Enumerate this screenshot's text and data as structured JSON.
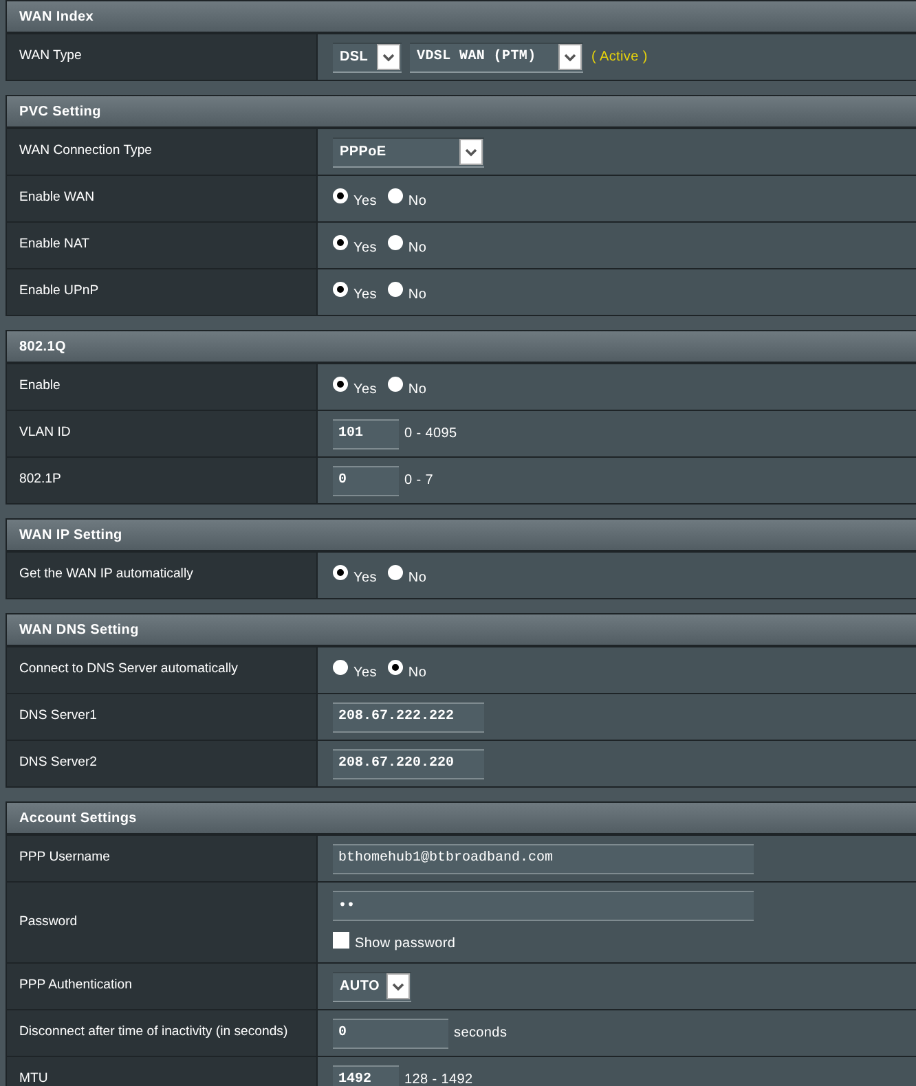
{
  "sections": [
    {
      "title": "WAN Index",
      "rows": [
        {
          "label": "WAN Type",
          "kind": "select",
          "selects": [
            "DSL",
            "VDSL WAN (PTM)"
          ],
          "note": "( Active )"
        }
      ]
    },
    {
      "title": "PVC Setting",
      "rows": [
        {
          "label": "WAN Connection Type",
          "kind": "select",
          "selects": [
            "PPPoE"
          ]
        },
        {
          "label": "Enable WAN",
          "kind": "radio",
          "options": [
            {
              "label": "Yes",
              "selected": true
            },
            {
              "label": "No",
              "selected": false
            }
          ]
        },
        {
          "label": "Enable NAT",
          "kind": "radio",
          "options": [
            {
              "label": "Yes",
              "selected": true
            },
            {
              "label": "No",
              "selected": false
            }
          ]
        },
        {
          "label": "Enable UPnP",
          "kind": "radio",
          "options": [
            {
              "label": "Yes",
              "selected": true
            },
            {
              "label": "No",
              "selected": false
            }
          ]
        }
      ]
    },
    {
      "title": "802.1Q",
      "rows": [
        {
          "label": "Enable",
          "kind": "radio",
          "options": [
            {
              "label": "Yes",
              "selected": true
            },
            {
              "label": "No",
              "selected": false
            }
          ]
        },
        {
          "label": "VLAN ID",
          "kind": "input",
          "value": "101",
          "suffix": "0 - 4095"
        },
        {
          "label": "802.1P",
          "kind": "input",
          "value": "0",
          "suffix": "0 - 7"
        }
      ]
    },
    {
      "title": "WAN IP Setting",
      "rows": [
        {
          "label": "Get the WAN IP automatically",
          "kind": "radio",
          "options": [
            {
              "label": "Yes",
              "selected": true
            },
            {
              "label": "No",
              "selected": false
            }
          ]
        }
      ]
    },
    {
      "title": "WAN DNS Setting",
      "rows": [
        {
          "label": "Connect to DNS Server automatically",
          "kind": "radio",
          "options": [
            {
              "label": "Yes",
              "selected": false
            },
            {
              "label": "No",
              "selected": true
            }
          ]
        },
        {
          "label": "DNS Server1",
          "kind": "input",
          "value": "208.67.222.222"
        },
        {
          "label": "DNS Server2",
          "kind": "input",
          "value": "208.67.220.220"
        }
      ]
    },
    {
      "title": "Account Settings",
      "rows": [
        {
          "label": "PPP Username",
          "kind": "input",
          "value": "bthomehub1@btbroadband.com"
        },
        {
          "label": "Password",
          "kind": "password",
          "value": "••",
          "checkbox": {
            "label": "Show password",
            "checked": false
          }
        },
        {
          "label": "PPP Authentication",
          "kind": "select",
          "selects": [
            "AUTO"
          ]
        },
        {
          "label": "Disconnect after time of inactivity (in seconds)",
          "kind": "input",
          "value": "0",
          "suffix": "seconds"
        },
        {
          "label": "MTU",
          "kind": "input",
          "value": "1492",
          "suffix": "128 - 1492"
        }
      ]
    }
  ]
}
